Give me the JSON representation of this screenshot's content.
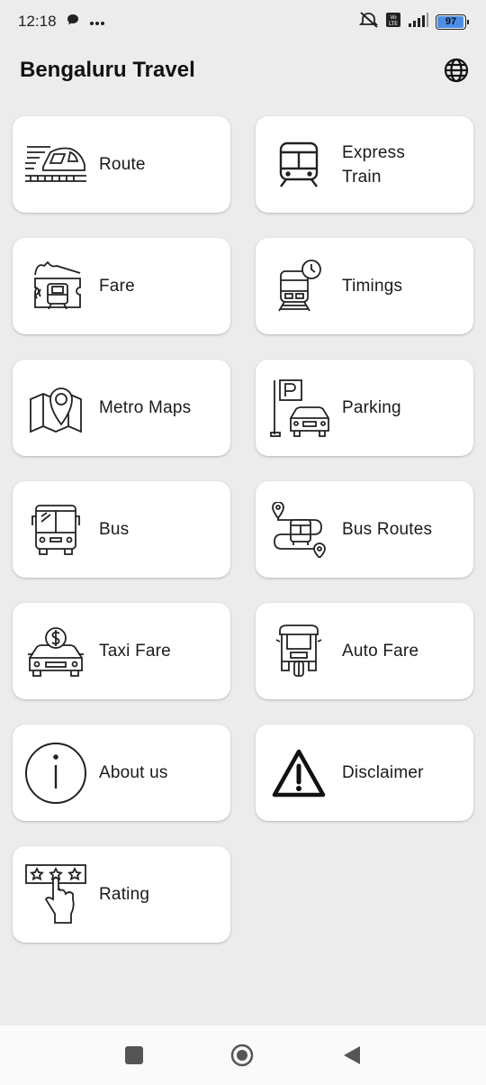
{
  "status": {
    "time": "12:18",
    "battery": "97",
    "icons": [
      "chat-bubble-icon",
      "more-dots-icon",
      "mute-icon",
      "volte-icon",
      "signal-icon",
      "battery-icon"
    ]
  },
  "header": {
    "title": "Bengaluru Travel",
    "language_icon": "globe-icon"
  },
  "menu": [
    {
      "label": "Route",
      "icon": "train-route-icon"
    },
    {
      "label": "Express\nTrain",
      "icon": "express-train-icon"
    },
    {
      "label": "Fare",
      "icon": "ticket-fare-icon"
    },
    {
      "label": "Timings",
      "icon": "train-clock-icon"
    },
    {
      "label": "Metro Maps",
      "icon": "map-pin-icon"
    },
    {
      "label": "Parking",
      "icon": "parking-car-icon"
    },
    {
      "label": "Bus",
      "icon": "bus-icon"
    },
    {
      "label": "Bus Routes",
      "icon": "bus-route-icon"
    },
    {
      "label": "Taxi Fare",
      "icon": "taxi-dollar-icon"
    },
    {
      "label": "Auto Fare",
      "icon": "auto-rickshaw-icon"
    },
    {
      "label": "About us",
      "icon": "info-icon"
    },
    {
      "label": "Disclaimer",
      "icon": "warning-icon"
    },
    {
      "label": "Rating",
      "icon": "rating-stars-icon"
    }
  ],
  "nav": {
    "icons": [
      "recents-square-icon",
      "home-circle-icon",
      "back-triangle-icon"
    ]
  },
  "colors": {
    "background": "#ececec",
    "card": "#ffffff",
    "battery_fill": "#4a8fe7"
  }
}
